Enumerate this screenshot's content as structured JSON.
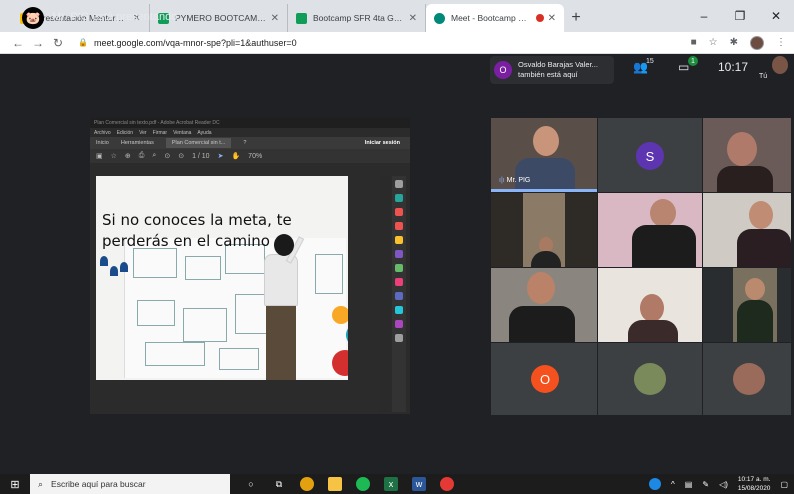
{
  "browser": {
    "tabs": [
      {
        "title": "Presentación Mentores - Google",
        "favicon_color": "#fbbc04",
        "active": false
      },
      {
        "title": "PYMERO BOOTCAMP - Hojas de",
        "favicon_color": "#0f9d58",
        "active": false
      },
      {
        "title": "Bootcamp SFR 4ta Gen. - Hojas",
        "favicon_color": "#0f9d58",
        "active": false
      },
      {
        "title": "Meet - Bootcamp SFR 4ta Ge",
        "favicon_color": "#00897b",
        "active": true
      }
    ],
    "new_tab": "+",
    "url": "meet.google.com/vqa-mnor-spe?pli=1&authuser=0"
  },
  "meet": {
    "presenting_text": "Mr. PIG está presentando",
    "join_notice": {
      "initial": "O",
      "name": "Osvaldo Barajas Valer...",
      "status": "también está aquí"
    },
    "participants_count": "15",
    "chat_badge": "1",
    "clock": "10:17",
    "self_label": "Tú"
  },
  "acrobat": {
    "title_bar": "Plan Comercial sin texto.pdf - Adobe Acrobat Reader DC",
    "menu": [
      "Archivo",
      "Edición",
      "Ver",
      "Firmar",
      "Ventana",
      "Ayuda"
    ],
    "tabs": [
      "Inicio",
      "Herramientas",
      "Plan Comercial sin t..."
    ],
    "login": "Iniciar sesión",
    "page_indicator": "1 / 10",
    "zoom": "70%"
  },
  "slide": {
    "title": "Si no conoces la meta, te perderás en el camino"
  },
  "grid": {
    "speaker_name": "Mr. PIG",
    "tiles": [
      {
        "initial": "S",
        "color": "#5e35b1"
      },
      {
        "initial": "O",
        "color": "#f4511e"
      }
    ]
  },
  "taskbar": {
    "search_placeholder": "Escribe aquí para buscar",
    "time": "10:17 a. m.",
    "date": "15/08/2020"
  }
}
